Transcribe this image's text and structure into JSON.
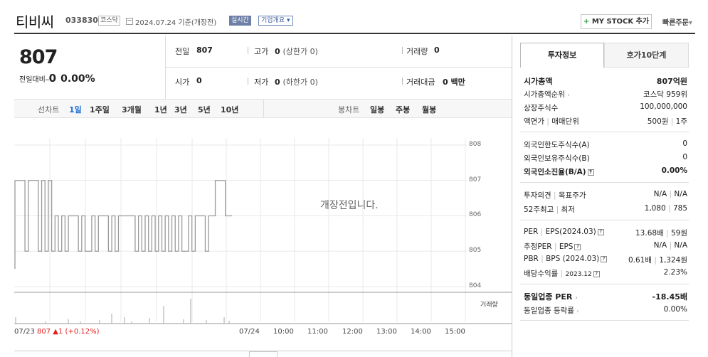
{
  "header": {
    "stock_name": "티비씨",
    "stock_code": "033830",
    "market_tag": "코스닥",
    "date_info": "2024.07.24 기준(개장전)",
    "realtime_tag": "실시간",
    "company_tag": "기업개요",
    "mystock_label": "MY STOCK 추가",
    "mystock_plus": "+",
    "quick_order": "빠른주문"
  },
  "price": {
    "current": "807",
    "change_label": "전일대비",
    "change_symbol": "━",
    "change_value": "0",
    "change_pct": "0.00%"
  },
  "quote": {
    "prev_label": "전일",
    "prev_value": "807",
    "high_label": "고가",
    "high_value": "0",
    "high_sub": "(상한가 0)",
    "volume_label": "거래량",
    "volume_value": "0",
    "open_label": "시가",
    "open_value": "0",
    "low_label": "저가",
    "low_value": "0",
    "low_sub": "(하한가 0)",
    "amount_label": "거래대금",
    "amount_value": "0 백만"
  },
  "toolbar": {
    "line_chart_label": "선차트",
    "periods": [
      "1일",
      "1주일",
      "3개월",
      "1년",
      "3년",
      "5년",
      "10년"
    ],
    "selected_period": "1일",
    "candle_label": "봉차트",
    "candles": [
      "일봉",
      "주봉",
      "월봉"
    ]
  },
  "chart": {
    "pre_open_message": "개장전입니다.",
    "volume_label": "거래량",
    "x_labels": [
      "07/24",
      "10:00",
      "11:00",
      "12:00",
      "13:00",
      "14:00",
      "15:00"
    ],
    "prev_summary": "07/23",
    "prev_price": "807",
    "prev_change": "▲1",
    "prev_pct": "(+0.12%)",
    "colors": {
      "line": "#9a9a9a",
      "up": "#e02020",
      "grid": "#e8e8e8"
    }
  },
  "chart_data": {
    "type": "line",
    "title": "",
    "xlabel": "",
    "ylabel": "",
    "y_ticks": [
      808,
      807,
      806,
      805,
      804
    ],
    "ylim": [
      804,
      808
    ],
    "x": [
      "07/23",
      "07/24",
      "10:00",
      "11:00",
      "12:00",
      "13:00",
      "14:00",
      "15:00"
    ],
    "series": [
      {
        "values": [
          807,
          807,
          807,
          805,
          807,
          807,
          807,
          805,
          807,
          805,
          807,
          805,
          806,
          805,
          806,
          805,
          806,
          806,
          806,
          805,
          806,
          805,
          805,
          806,
          805,
          806,
          806,
          806,
          805,
          806,
          805,
          806,
          806,
          806,
          806,
          806,
          805,
          806,
          805,
          806,
          805,
          806,
          805,
          806,
          805,
          806,
          805,
          806,
          805,
          806,
          805,
          805,
          806,
          805,
          806,
          806,
          806,
          805,
          806,
          806,
          807,
          807,
          807,
          806,
          806,
          806
        ]
      }
    ],
    "grid": true
  },
  "right_panel": {
    "tab_invest": "투자정보",
    "tab_orderbook": "호가10단계",
    "mcap_label": "시가총액",
    "mcap_value": "807억원",
    "mcap_rank_label": "시가총액순위",
    "mcap_rank_value": "코스닥 959위",
    "shares_label": "상장주식수",
    "shares_value": "100,000,000",
    "par_label": "액면가",
    "par_label2": "매매단위",
    "par_value": "500원",
    "par_value2": "1주",
    "foreign_limit_label": "외국인한도주식수(A)",
    "foreign_limit_value": "0",
    "foreign_hold_label": "외국인보유주식수(B)",
    "foreign_hold_value": "0",
    "foreign_ratio_label": "외국인소진율(B/A)",
    "foreign_ratio_value": "0.00%",
    "opinion_label": "투자의견",
    "target_label": "목표주가",
    "opinion_value": "N/A",
    "target_value": "N/A",
    "w52_label": "52주최고",
    "w52_low_label": "최저",
    "w52_high": "1,080",
    "w52_low": "785",
    "per_label": "PER",
    "eps_label": "EPS(2024.03)",
    "per_value": "13.68배",
    "eps_value": "59원",
    "est_per_label": "추정PER",
    "est_eps_label": "EPS",
    "est_per_value": "N/A",
    "est_eps_value": "N/A",
    "pbr_label": "PBR",
    "bps_label": "BPS (2024.03)",
    "pbr_value": "0.61배",
    "bps_value": "1,324원",
    "div_label": "배당수익률",
    "div_date": "2023.12",
    "div_value": "2.23%",
    "sector_per_label": "동일업종 PER",
    "sector_per_value": "-18.45배",
    "sector_rate_label": "동일업종 등락률",
    "sector_rate_value": "0.00%"
  }
}
